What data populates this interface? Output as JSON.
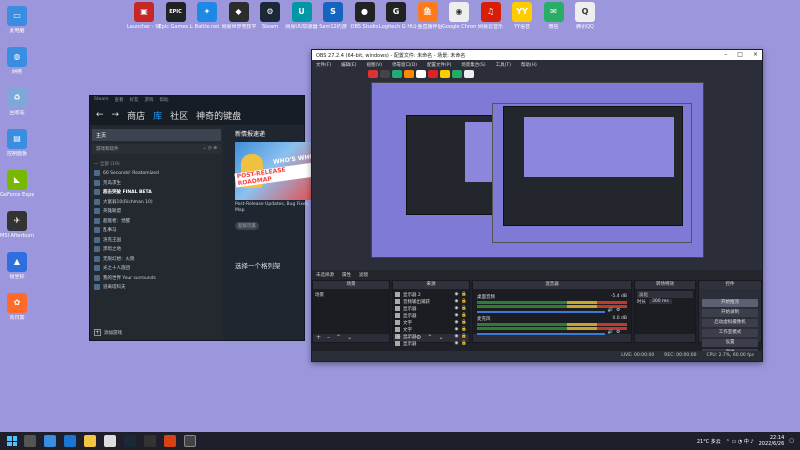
{
  "desktop_left": [
    {
      "label": "此电脑",
      "color": "#3a8de0",
      "glyph": "▭",
      "name": "this-pc-icon"
    },
    {
      "label": "网络",
      "color": "#3a8de0",
      "glyph": "◍",
      "name": "network-icon"
    },
    {
      "label": "回收站",
      "color": "#7ea8d8",
      "glyph": "♻",
      "name": "recycle-bin-icon"
    },
    {
      "label": "控制面板",
      "color": "#3a8de0",
      "glyph": "▤",
      "name": "control-panel-icon"
    },
    {
      "label": "GeForce Experience",
      "color": "#76b900",
      "glyph": "◣",
      "name": "geforce-icon"
    },
    {
      "label": "MSI Afterburner",
      "color": "#333",
      "glyph": "✈",
      "name": "msi-afterburner-icon"
    },
    {
      "label": "极坐标",
      "color": "#2f6ee0",
      "glyph": "▲",
      "name": "app-icon"
    },
    {
      "label": "向日葵",
      "color": "#ff6a2a",
      "glyph": "✿",
      "name": "sunflower-icon"
    }
  ],
  "desktop_top": [
    {
      "label": "Launcher - 快捷方式",
      "color": "#c62828",
      "glyph": "▣",
      "name": "launcher-icon"
    },
    {
      "label": "Epic Games Launcher",
      "color": "#222",
      "glyph": "EPIC",
      "name": "epic-games-icon"
    },
    {
      "label": "Battle.net",
      "color": "#1e88e5",
      "glyph": "✦",
      "name": "battlenet-icon"
    },
    {
      "label": "网易世界竞技平台",
      "color": "#2c2c2c",
      "glyph": "◆",
      "name": "netease-arena-icon"
    },
    {
      "label": "Steam",
      "color": "#1b2838",
      "glyph": "⚙",
      "name": "steam-icon"
    },
    {
      "label": "网易UU加速器",
      "color": "#0097a7",
      "glyph": "U",
      "name": "uu-accelerator-icon"
    },
    {
      "label": "Sam12约游",
      "color": "#1565c0",
      "glyph": "S",
      "name": "sam-icon"
    },
    {
      "label": "OBS Studio",
      "color": "#222",
      "glyph": "●",
      "name": "obs-icon"
    },
    {
      "label": "Logitech G HUB",
      "color": "#222",
      "glyph": "G",
      "name": "logitech-icon"
    },
    {
      "label": "斗鱼直播伴侣",
      "color": "#ff7a1a",
      "glyph": "鱼",
      "name": "douyu-icon"
    },
    {
      "label": "Google Chrome",
      "color": "#eeeeee",
      "glyph": "◉",
      "name": "chrome-icon"
    },
    {
      "label": "网易云音乐",
      "color": "#d81e06",
      "glyph": "♫",
      "name": "netease-music-icon"
    },
    {
      "label": "YY语音",
      "color": "#ffcc00",
      "glyph": "YY",
      "name": "yy-icon"
    },
    {
      "label": "微信",
      "color": "#2aae67",
      "glyph": "✉",
      "name": "wechat-icon"
    },
    {
      "label": "腾讯QQ",
      "color": "#eeeeee",
      "glyph": "Q",
      "name": "qq-icon"
    }
  ],
  "steam": {
    "menu": [
      "Steam",
      "查看",
      "好友",
      "游戏",
      "帮助"
    ],
    "nav": {
      "store": "商店",
      "library": "库",
      "community": "社区",
      "user": "神奇的键盘"
    },
    "home": "主页",
    "filter": "游戏和软件",
    "games": [
      {
        "label": "— 全部 (19)",
        "type": "hdr"
      },
      {
        "label": "60 Seconds! Reatomized",
        "type": ""
      },
      {
        "label": "荒岛求生",
        "type": ""
      },
      {
        "label": "超击突破 FINAL BETA",
        "type": "hl"
      },
      {
        "label": "大富翁10(Richman 10)",
        "type": ""
      },
      {
        "label": "英雄联盟",
        "type": ""
      },
      {
        "label": "超能者：觉醒",
        "type": ""
      },
      {
        "label": "乱事马",
        "type": ""
      },
      {
        "label": "洛克王国",
        "type": ""
      },
      {
        "label": "黑暗之地",
        "type": ""
      },
      {
        "label": "无限幻想：火陨",
        "type": ""
      },
      {
        "label": "光之十人旅团",
        "type": ""
      },
      {
        "label": "我的世界 Your surrounds",
        "type": ""
      },
      {
        "label": "逃离塔科夫",
        "type": ""
      }
    ],
    "add_game": "添加游戏",
    "news_title": "新情报速递",
    "news_badge1": "WHO'S WHO",
    "news_badge2": "POST-RELEASE ROADMAP",
    "news_desc": "Post-Release Updates, Bug Fixes, Road Map",
    "news_tag": "超级玩家",
    "shelf": "选择一个格列架"
  },
  "obs": {
    "title": "OBS 27.2.4 (64-bit, windows) - 配置文件: 未命名 - 场景: 未命名",
    "menu": [
      "文件(F)",
      "编辑(E)",
      "视图(V)",
      "停靠窗口(D)",
      "配置文件(P)",
      "场景集合(S)",
      "工具(T)",
      "帮助(H)"
    ],
    "status_row": [
      "未选择源",
      "属性",
      "滤镜"
    ],
    "panels": {
      "scenes": "场景",
      "sources": "来源",
      "mixer": "混音器",
      "transitions": "转场特效",
      "controls": "控件"
    },
    "scene_item": "场景",
    "sources_list": [
      "显示器 2",
      "音频输出捕获",
      "显示器",
      "显示器",
      "文字",
      "文字",
      "显示器",
      "显示器"
    ],
    "mixer": [
      {
        "name": "桌面音频",
        "db": "-5.4 dB"
      },
      {
        "name": "麦克风",
        "db": "0.0 dB"
      }
    ],
    "transition": {
      "type": "淡化",
      "duration_label": "时长",
      "duration": "300 ms"
    },
    "controls": [
      "开始推流",
      "开始录制",
      "启动虚拟摄像机",
      "工作室模式",
      "设置",
      "退出"
    ],
    "status": {
      "live": "LIVE: 00:00:00",
      "rec": "REC: 00:00:00",
      "cpu": "CPU: 2.7%, 60.00 fps"
    }
  },
  "taskbar": {
    "weather": "21°C 多云",
    "time": "22:14",
    "date": "2022/6/26"
  }
}
